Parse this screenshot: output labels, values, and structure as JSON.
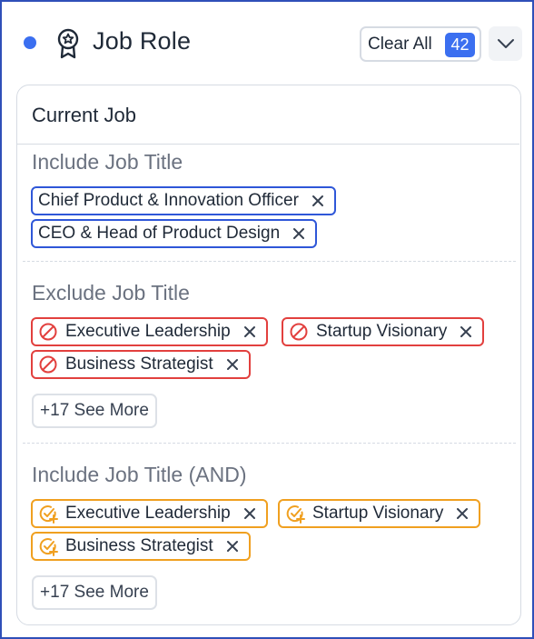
{
  "header": {
    "title": "Job Role",
    "clear_all_label": "Clear All",
    "clear_all_count": "42",
    "status_color": "#3b6ff0"
  },
  "panel": {
    "title": "Current Job",
    "sections": [
      {
        "title": "Include Job Title",
        "color": "#2f57d8",
        "chips": [
          "Chief Product & Innovation Officer",
          "CEO & Head of Product Design"
        ]
      },
      {
        "title": "Exclude Job Title",
        "color": "#e2403e",
        "icon": "ban-icon",
        "chips": [
          "Executive Leadership",
          "Startup Visionary",
          "Business Strategist"
        ],
        "see_more": "+17 See More"
      },
      {
        "title": "Include Job Title (AND)",
        "color": "#f0a020",
        "icon": "check-plus-icon",
        "chips": [
          "Executive Leadership",
          "Startup Visionary",
          "Business Strategist"
        ],
        "see_more": "+17 See More"
      }
    ]
  },
  "icons": {
    "title_icon": "award-icon",
    "dropdown": "chevron-down-icon",
    "remove": "close-icon"
  }
}
